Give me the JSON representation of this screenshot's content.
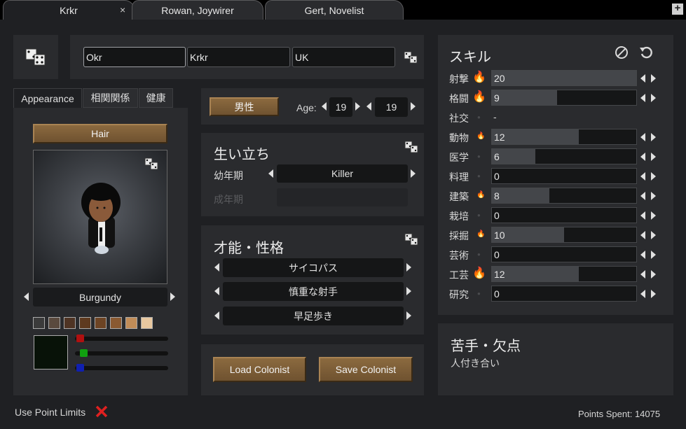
{
  "tabs": [
    {
      "label": "Krkr",
      "active": true,
      "close_icon": "×"
    },
    {
      "label": "Rowan, Joywirer",
      "active": false
    },
    {
      "label": "Gert, Novelist",
      "active": false
    }
  ],
  "add_tab_label": "+",
  "name": {
    "first": "Okr",
    "nick": "Krkr",
    "last": "UK"
  },
  "appearance_tabs": [
    "Appearance",
    "相関関係",
    "健康"
  ],
  "hair_button": "Hair",
  "hair_color_name": "Burgundy",
  "skin_swatches": [
    "#3b3b3b",
    "#5a4a3e",
    "#4f3424",
    "#5e3a1f",
    "#6d4424",
    "#8a5a32",
    "#c08c58",
    "#e8c8a0"
  ],
  "custom_color": "#081208",
  "rgb_sliders": [
    {
      "channel": "red",
      "color": "#b01010",
      "value": 0.03
    },
    {
      "channel": "green",
      "color": "#10a010",
      "value": 0.07
    },
    {
      "channel": "blue",
      "color": "#1020b0",
      "value": 0.03
    }
  ],
  "gender_button": "男性",
  "age": {
    "label": "Age:",
    "biological": "19",
    "chronological": "19"
  },
  "backstory": {
    "title": "生い立ち",
    "childhood_label": "幼年期",
    "childhood_value": "Killer",
    "adulthood_label": "成年期",
    "adulthood_value": ""
  },
  "traits": {
    "title": "才能・性格",
    "items": [
      "サイコパス",
      "慎重な射手",
      "早足歩き"
    ]
  },
  "buttons": {
    "load": "Load Colonist",
    "save": "Save Colonist"
  },
  "skills": {
    "title": "スキル",
    "ban_icon": "ban-icon",
    "reset_icon": "undo-icon",
    "rows": [
      {
        "name": "射撃",
        "passion": "major",
        "value": "20",
        "level": 20,
        "has_bar": true
      },
      {
        "name": "格闘",
        "passion": "major",
        "value": "9",
        "level": 9,
        "has_bar": true
      },
      {
        "name": "社交",
        "passion": "none",
        "value": "-",
        "level": 0,
        "has_bar": false
      },
      {
        "name": "動物",
        "passion": "minor",
        "value": "12",
        "level": 12,
        "has_bar": true
      },
      {
        "name": "医学",
        "passion": "none",
        "value": "6",
        "level": 6,
        "has_bar": true
      },
      {
        "name": "料理",
        "passion": "none",
        "value": "0",
        "level": 0,
        "has_bar": true
      },
      {
        "name": "建築",
        "passion": "minor",
        "value": "8",
        "level": 8,
        "has_bar": true
      },
      {
        "name": "栽培",
        "passion": "none",
        "value": "0",
        "level": 0,
        "has_bar": true
      },
      {
        "name": "採掘",
        "passion": "minor",
        "value": "10",
        "level": 10,
        "has_bar": true
      },
      {
        "name": "芸術",
        "passion": "none",
        "value": "0",
        "level": 0,
        "has_bar": true
      },
      {
        "name": "工芸",
        "passion": "major",
        "value": "12",
        "level": 12,
        "has_bar": true
      },
      {
        "name": "研究",
        "passion": "none",
        "value": "0",
        "level": 0,
        "has_bar": true
      }
    ]
  },
  "incapable": {
    "title": "苦手・欠点",
    "items": "人付き合い"
  },
  "footer": {
    "point_limits": "Use Point Limits",
    "points_spent": "Points Spent: 14075"
  }
}
